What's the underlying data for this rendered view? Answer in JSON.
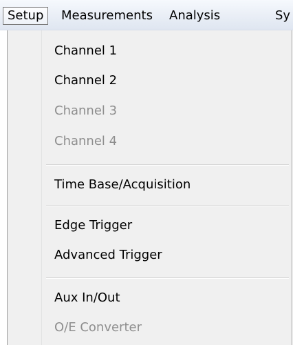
{
  "menubar": {
    "items": [
      {
        "label": "Setup",
        "active": true
      },
      {
        "label": "Measurements"
      },
      {
        "label": "Analysis"
      },
      {
        "label": "Sy"
      }
    ]
  },
  "dropdown": {
    "groups": [
      {
        "items": [
          {
            "label": "Channel 1",
            "enabled": true
          },
          {
            "label": "Channel 2",
            "enabled": true
          },
          {
            "label": "Channel 3",
            "enabled": false
          },
          {
            "label": "Channel 4",
            "enabled": false
          }
        ]
      },
      {
        "items": [
          {
            "label": "Time Base/Acquisition",
            "enabled": true
          }
        ]
      },
      {
        "items": [
          {
            "label": "Edge Trigger",
            "enabled": true
          },
          {
            "label": "Advanced Trigger",
            "enabled": true
          }
        ]
      },
      {
        "items": [
          {
            "label": "Aux In/Out",
            "enabled": true
          },
          {
            "label": "O/E Converter",
            "enabled": false
          }
        ]
      }
    ]
  },
  "colors": {
    "disabled_text": "#8e8e8e",
    "menu_background": "#f0f0f0"
  }
}
